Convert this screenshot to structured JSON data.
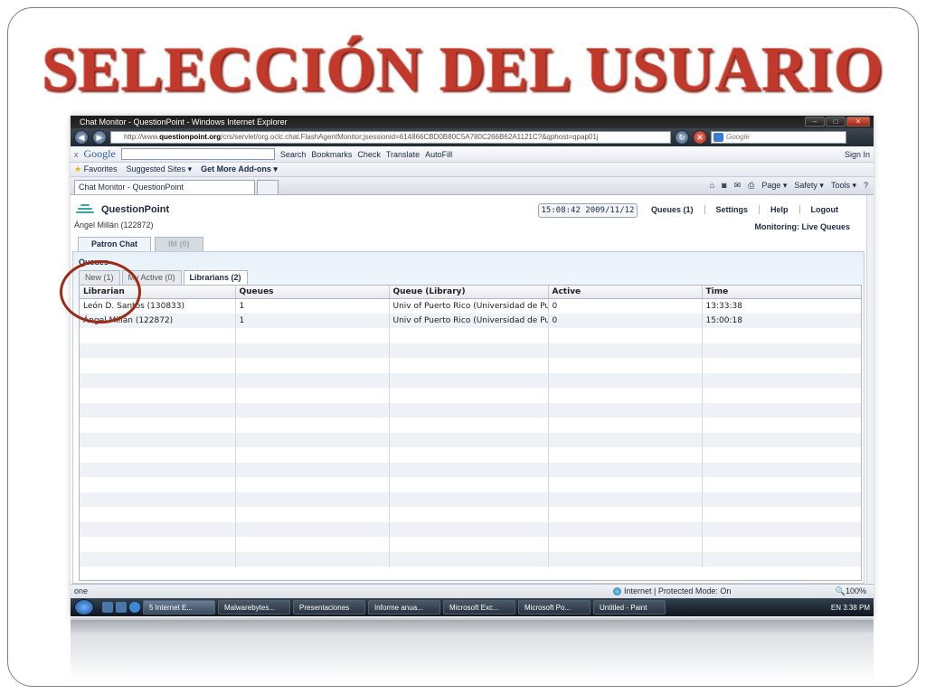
{
  "slide": {
    "title": "SELECCIÓN DEL USUARIO"
  },
  "browser": {
    "window_title": "Chat Monitor - QuestionPoint - Windows Internet Explorer",
    "url_prefix": "http://www.",
    "url_host": "questionpoint.org",
    "url_rest": "/crs/servlet/org.oclc.chat.FlashAgentMonitor;jsessionid=614866CBD0B80C5A780C266B62A1121C?&qphost=qpap01j",
    "search_placeholder": "Google",
    "google_bar": {
      "close": "x",
      "logo": "Google",
      "search_label": "Search",
      "bookmarks_label": "Bookmarks",
      "check_label": "Check",
      "translate_label": "Translate",
      "autofill_label": "AutoFill",
      "sign_in_label": "Sign In"
    },
    "favorites_bar": {
      "favorites_label": "Favorites",
      "suggested_label": "Suggested Sites ▾",
      "addons_label": "Get More Add-ons ▾"
    },
    "tab_label": "Chat Monitor - QuestionPoint",
    "command_bar": {
      "page_label": "Page ▾",
      "safety_label": "Safety ▾",
      "tools_label": "Tools ▾"
    },
    "status": {
      "left": "one",
      "zone": "Internet | Protected Mode: On",
      "zoom": "100%"
    }
  },
  "app": {
    "logo_text": "QuestionPoint",
    "user": "Ángel Millán (122872)",
    "clock": "15:08:42 2009/11/12",
    "nav": {
      "queues": "Queues (1)",
      "settings": "Settings",
      "help": "Help",
      "logout": "Logout"
    },
    "monitoring": "Monitoring: Live Queues",
    "tabs": {
      "patron_chat": "Patron Chat",
      "im": "IM (0)"
    },
    "panel_title": "Queues",
    "sub_tabs": {
      "new": "New (1)",
      "my_active": "My Active (0)",
      "librarians": "Librarians (2)"
    },
    "table": {
      "headers": [
        "Librarian",
        "Queues",
        "Queue (Library)",
        "Active",
        "Time"
      ],
      "rows": [
        [
          "León D. Santos (130833)",
          "1",
          "Univ of Puerto Rico (Universidad de Pu",
          "0",
          "13:33:38"
        ],
        [
          "Ángel Millán (122872)",
          "1",
          "Univ of Puerto Rico (Universidad de Pu",
          "0",
          "15:00:18"
        ]
      ]
    }
  },
  "taskbar": {
    "items": [
      "5 Internet E...",
      "Malwarebytes...",
      "Presentaciones",
      "Informe anua...",
      "Microsoft Exc...",
      "Microsoft Po...",
      "Untitled - Paint"
    ],
    "tray": "EN   3:38 PM"
  }
}
